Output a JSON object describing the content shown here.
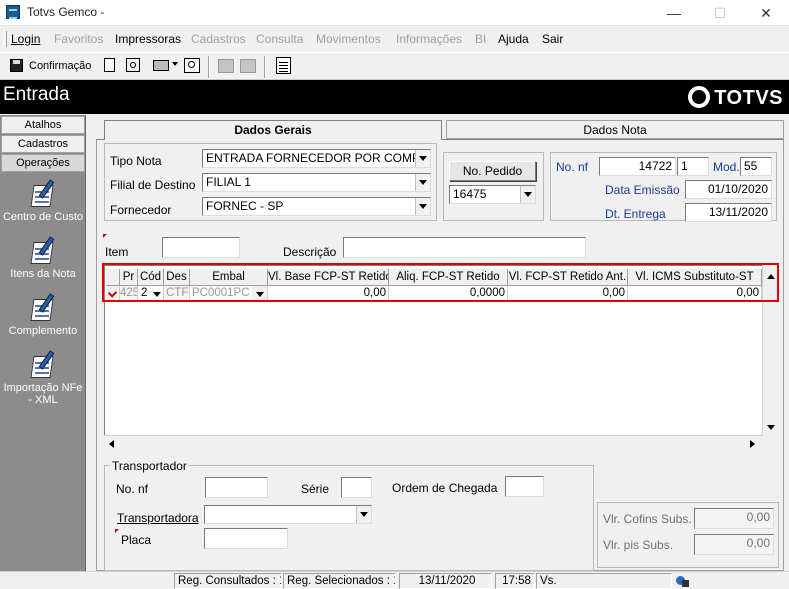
{
  "window": {
    "title": "Totvs Gemco -",
    "min": "—",
    "max": "☐",
    "close": "✕"
  },
  "menu": {
    "login": "Login",
    "favoritos": "Favoritos",
    "impressoras": "Impressoras",
    "cadastros": "Cadastros",
    "consulta": "Consulta",
    "movimentos": "Movimentos",
    "informacoes": "Informações",
    "bi": "BI",
    "ajuda": "Ajuda",
    "sair": "Sair"
  },
  "toolbar": {
    "confirmacao": "Confirmação"
  },
  "header": {
    "title": "Entrada",
    "brand": "TOTVS"
  },
  "sidebar": {
    "tabs": {
      "atalhos": "Atalhos",
      "cadastros": "Cadastros",
      "operacoes": "Operações"
    },
    "items": {
      "centro": "Centro de Custo",
      "itens": "Itens da Nota",
      "complemento": "Complemento",
      "importacao1": "Importação NFe",
      "importacao2": "- XML"
    }
  },
  "tabs": {
    "dados_gerais": "Dados Gerais",
    "dados_nota": "Dados Nota"
  },
  "form": {
    "tipo_nota_label": "Tipo Nota",
    "tipo_nota_value": "ENTRADA FORNECEDOR POR COMPRAS",
    "filial_label": "Filial de Destino",
    "filial_value": "FILIAL 1",
    "fornecedor_label": "Fornecedor",
    "fornecedor_value": "FORNEC - SP",
    "no_pedido_button": "No. Pedido",
    "pedido_value": "16475",
    "no_nf_label": "No. nf",
    "no_nf_value": "14722",
    "serie_value": "1",
    "mod_label": "Mod.",
    "mod_value": "55",
    "data_emissao_label": "Data Emissão",
    "data_emissao_value": "01/10/2020",
    "dt_entrega_label": "Dt. Entrega",
    "dt_entrega_value": "13/11/2020",
    "item_label": "Item",
    "item_value": "",
    "descricao_label": "Descrição",
    "descricao_value": ""
  },
  "grid": {
    "headers": {
      "pr": "Pr",
      "cod": "Cód",
      "des": "Des",
      "embal": "Embal",
      "vl_base": "Vl. Base FCP-ST Retido",
      "aliq": "Aliq. FCP-ST Retido",
      "vl_fcp": "Vl. FCP-ST Retido Ant.",
      "vl_icms": "Vl. ICMS Substituto-ST"
    },
    "row": {
      "pr": "425",
      "cod": "2",
      "des": "CTF",
      "embal": "PC0001PC",
      "vl_base": "0,00",
      "aliq": "0,0000",
      "vl_fcp": "0,00",
      "vl_icms": "0,00"
    }
  },
  "transportador": {
    "legend": "Transportador",
    "no_nf_label": "No. nf",
    "no_nf_value": "",
    "serie_label": "Série",
    "serie_value": "",
    "ordem_label": "Ordem de Chegada",
    "ordem_value": "",
    "transportadora_label": "Transportadora",
    "transportadora_value": "",
    "placa_label": "Placa",
    "placa_value": ""
  },
  "totais": {
    "cofins_label": "Vlr. Cofins Subs.",
    "cofins_value": "0,00",
    "pis_label": "Vlr. pis Subs.",
    "pis_value": "0,00"
  },
  "status": {
    "consultados": "Reg. Consultados : 1",
    "selecionados": "Reg. Selecionados : 1",
    "date": "13/11/2020",
    "time": "17:58",
    "vs": "Vs."
  }
}
